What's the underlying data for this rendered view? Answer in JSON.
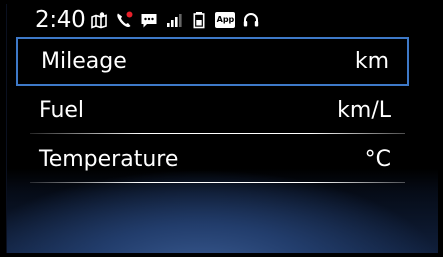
{
  "status_bar": {
    "time": "2:40",
    "app_badge": "App",
    "icons": [
      "navigation-map-icon",
      "missed-call-icon",
      "message-icon",
      "signal-strength-icon",
      "battery-icon",
      "app-icon",
      "headset-icon"
    ],
    "missed_call_color": "#e8202a"
  },
  "menu": {
    "items": [
      {
        "label": "Mileage",
        "unit": "km",
        "selected": true
      },
      {
        "label": "Fuel",
        "unit": "km/L",
        "selected": false
      },
      {
        "label": "Temperature",
        "unit": "°C",
        "selected": false
      }
    ]
  },
  "colors": {
    "background": "#000000",
    "selection_border": "#3e79c8",
    "text": "#ffffff",
    "bottom_glow": "#3a5b92"
  }
}
